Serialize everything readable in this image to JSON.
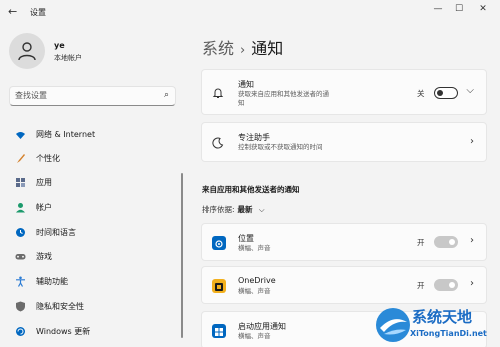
{
  "window": {
    "title": "设置",
    "back_icon": "←",
    "controls": [
      "—",
      "☐",
      "✕"
    ]
  },
  "user": {
    "name": "ye",
    "account_type": "本地帐户"
  },
  "search": {
    "placeholder": "查找设置"
  },
  "sidebar": {
    "items": [
      {
        "label": "网络 & Internet",
        "icon": "wifi-icon",
        "color": "#0067c0"
      },
      {
        "label": "个性化",
        "icon": "brush-icon",
        "color": "#d4802a"
      },
      {
        "label": "应用",
        "icon": "apps-icon",
        "color": "#5a6a8a"
      },
      {
        "label": "帐户",
        "icon": "person-icon",
        "color": "#1c9a6c"
      },
      {
        "label": "时间和语言",
        "icon": "globe-clock-icon",
        "color": "#0067c0"
      },
      {
        "label": "游戏",
        "icon": "gamepad-icon",
        "color": "#6b6b6b"
      },
      {
        "label": "辅助功能",
        "icon": "accessibility-icon",
        "color": "#2a7bd4"
      },
      {
        "label": "隐私和安全性",
        "icon": "shield-icon",
        "color": "#6b6b6b"
      },
      {
        "label": "Windows 更新",
        "icon": "update-icon",
        "color": "#0067c0"
      }
    ]
  },
  "breadcrumb": {
    "parent": "系统",
    "separator": "›",
    "current": "通知"
  },
  "notifications_card": {
    "title": "通知",
    "subtitle_line1": "获取来自应用和其他发送者的通",
    "subtitle_line2": "知",
    "toggle_label": "关",
    "toggle_state": "off"
  },
  "focus_card": {
    "title": "专注助手",
    "subtitle": "控制获取或不获取通知的时间"
  },
  "section": {
    "heading": "来自应用和其他发送者的通知",
    "sort_label": "排序依据:",
    "sort_value": "最新",
    "sort_chevron": "⌵"
  },
  "apps": [
    {
      "name": "位置",
      "subtitle": "横幅、声音",
      "toggle_label": "开",
      "icon": "location-icon",
      "icon_color": "#0067c0"
    },
    {
      "name": "OneDrive",
      "subtitle": "横幅、声音",
      "toggle_label": "开",
      "icon": "onedrive-icon",
      "icon_color": "#f2b01e"
    },
    {
      "name": "启动应用通知",
      "subtitle": "横幅、声音",
      "toggle_label": "",
      "icon": "startup-apps-icon",
      "icon_color": "#0067c0"
    }
  ],
  "watermark": {
    "text": "系统天地",
    "url": "XiTongTianDi.net"
  }
}
